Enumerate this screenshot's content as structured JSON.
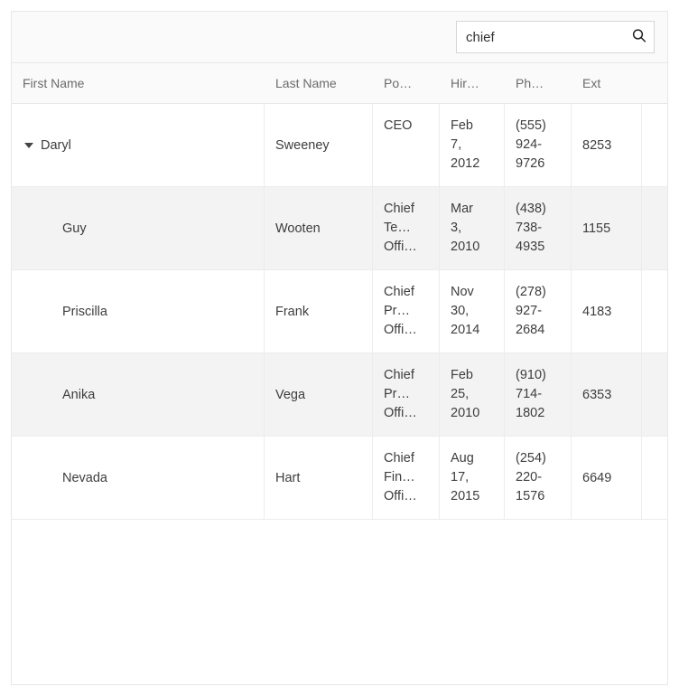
{
  "search": {
    "value": "chief"
  },
  "columns": {
    "first_name": "First Name",
    "last_name": "Last Name",
    "position": "Po…",
    "hire_date": "Hir…",
    "phone": "Ph…",
    "ext": "Ext"
  },
  "rows": [
    {
      "level": 0,
      "expanded": true,
      "first_name": "Daryl",
      "last_name": "Sweeney",
      "position": "CEO",
      "position_lines": [
        "CEO"
      ],
      "hire_lines": [
        "Feb",
        "7,",
        "2012"
      ],
      "phone_lines": [
        "(555)",
        "924-",
        "9726"
      ],
      "ext": "8253",
      "alt": false
    },
    {
      "level": 1,
      "expanded": false,
      "first_name": "Guy",
      "last_name": "Wooten",
      "position": "Chief Technical Officer",
      "position_lines": [
        "Chief",
        "Te…",
        "Offi…"
      ],
      "hire_lines": [
        "Mar",
        "3,",
        "2010"
      ],
      "phone_lines": [
        "(438)",
        "738-",
        "4935"
      ],
      "ext": "1155",
      "alt": true
    },
    {
      "level": 1,
      "expanded": false,
      "first_name": "Priscilla",
      "last_name": "Frank",
      "position": "Chief Product Officer",
      "position_lines": [
        "Chief",
        "Pr…",
        "Offi…"
      ],
      "hire_lines": [
        "Nov",
        "30,",
        "2014"
      ],
      "phone_lines": [
        "(278)",
        "927-",
        "2684"
      ],
      "ext": "4183",
      "alt": false
    },
    {
      "level": 1,
      "expanded": false,
      "first_name": "Anika",
      "last_name": "Vega",
      "position": "Chief Process Officer",
      "position_lines": [
        "Chief",
        "Pr…",
        "Offi…"
      ],
      "hire_lines": [
        "Feb",
        "25,",
        "2010"
      ],
      "phone_lines": [
        "(910)",
        "714-",
        "1802"
      ],
      "ext": "6353",
      "alt": true
    },
    {
      "level": 1,
      "expanded": false,
      "first_name": "Nevada",
      "last_name": "Hart",
      "position": "Chief Financial Officer",
      "position_lines": [
        "Chief",
        "Fin…",
        "Offi…"
      ],
      "hire_lines": [
        "Aug",
        "17,",
        "2015"
      ],
      "phone_lines": [
        "(254)",
        "220-",
        "1576"
      ],
      "ext": "6649",
      "alt": false
    }
  ]
}
